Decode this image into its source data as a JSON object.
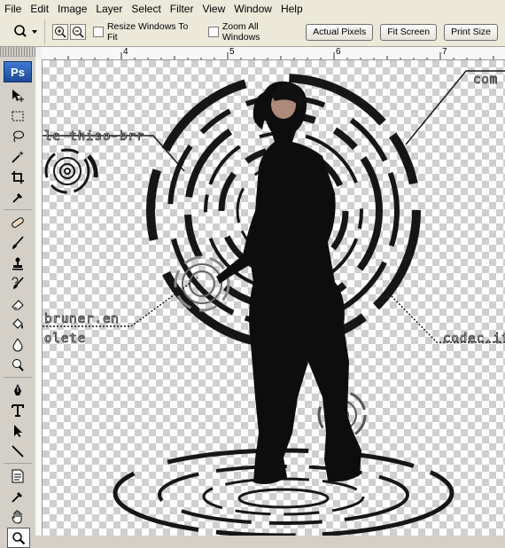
{
  "menu": [
    "File",
    "Edit",
    "Image",
    "Layer",
    "Select",
    "Filter",
    "View",
    "Window",
    "Help"
  ],
  "options": {
    "resize_windows": "Resize Windows To Fit",
    "zoom_all_windows": "Zoom All Windows",
    "actual_pixels": "Actual Pixels",
    "fit_screen": "Fit Screen",
    "print_size": "Print Size"
  },
  "toolbox": {
    "logo": "Ps"
  },
  "ruler": {
    "ticks": [
      "4",
      "5",
      "6",
      "7"
    ]
  },
  "canvas": {
    "texts": [
      "com",
      "le thiso-brr",
      "bruner.en",
      "olete",
      "codec.it"
    ]
  }
}
